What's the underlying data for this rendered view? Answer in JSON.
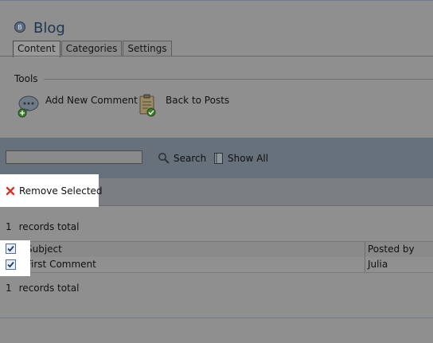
{
  "header": {
    "title": "Blog",
    "icon": "blog-icon"
  },
  "tabs": [
    {
      "label": "Content",
      "active": true
    },
    {
      "label": "Categories",
      "active": false
    },
    {
      "label": "Settings",
      "active": false
    }
  ],
  "tools": {
    "label": "Tools",
    "add_comment": {
      "label": "Add New Comment",
      "icon": "add-comment-icon"
    },
    "back_to_posts": {
      "label": "Back to Posts",
      "icon": "back-to-posts-icon"
    }
  },
  "search": {
    "input_value": "",
    "search_label": "Search",
    "show_all_label": "Show All"
  },
  "actions": {
    "remove_selected_label": "Remove Selected"
  },
  "records_top": {
    "count": "1",
    "label": "records total"
  },
  "records_bottom": {
    "count": "1",
    "label": "records total"
  },
  "table": {
    "headers": {
      "subject": "Subject",
      "posted_by": "Posted by"
    },
    "rows": [
      {
        "subject": "First Comment",
        "posted_by": "Julia",
        "checked": true
      }
    ],
    "header_checked": true
  },
  "colors": {
    "overlay_bg": "#8f8f8f",
    "search_bar": "#66717c",
    "title": "#1f3550",
    "remove_icon": "#d2362b"
  }
}
